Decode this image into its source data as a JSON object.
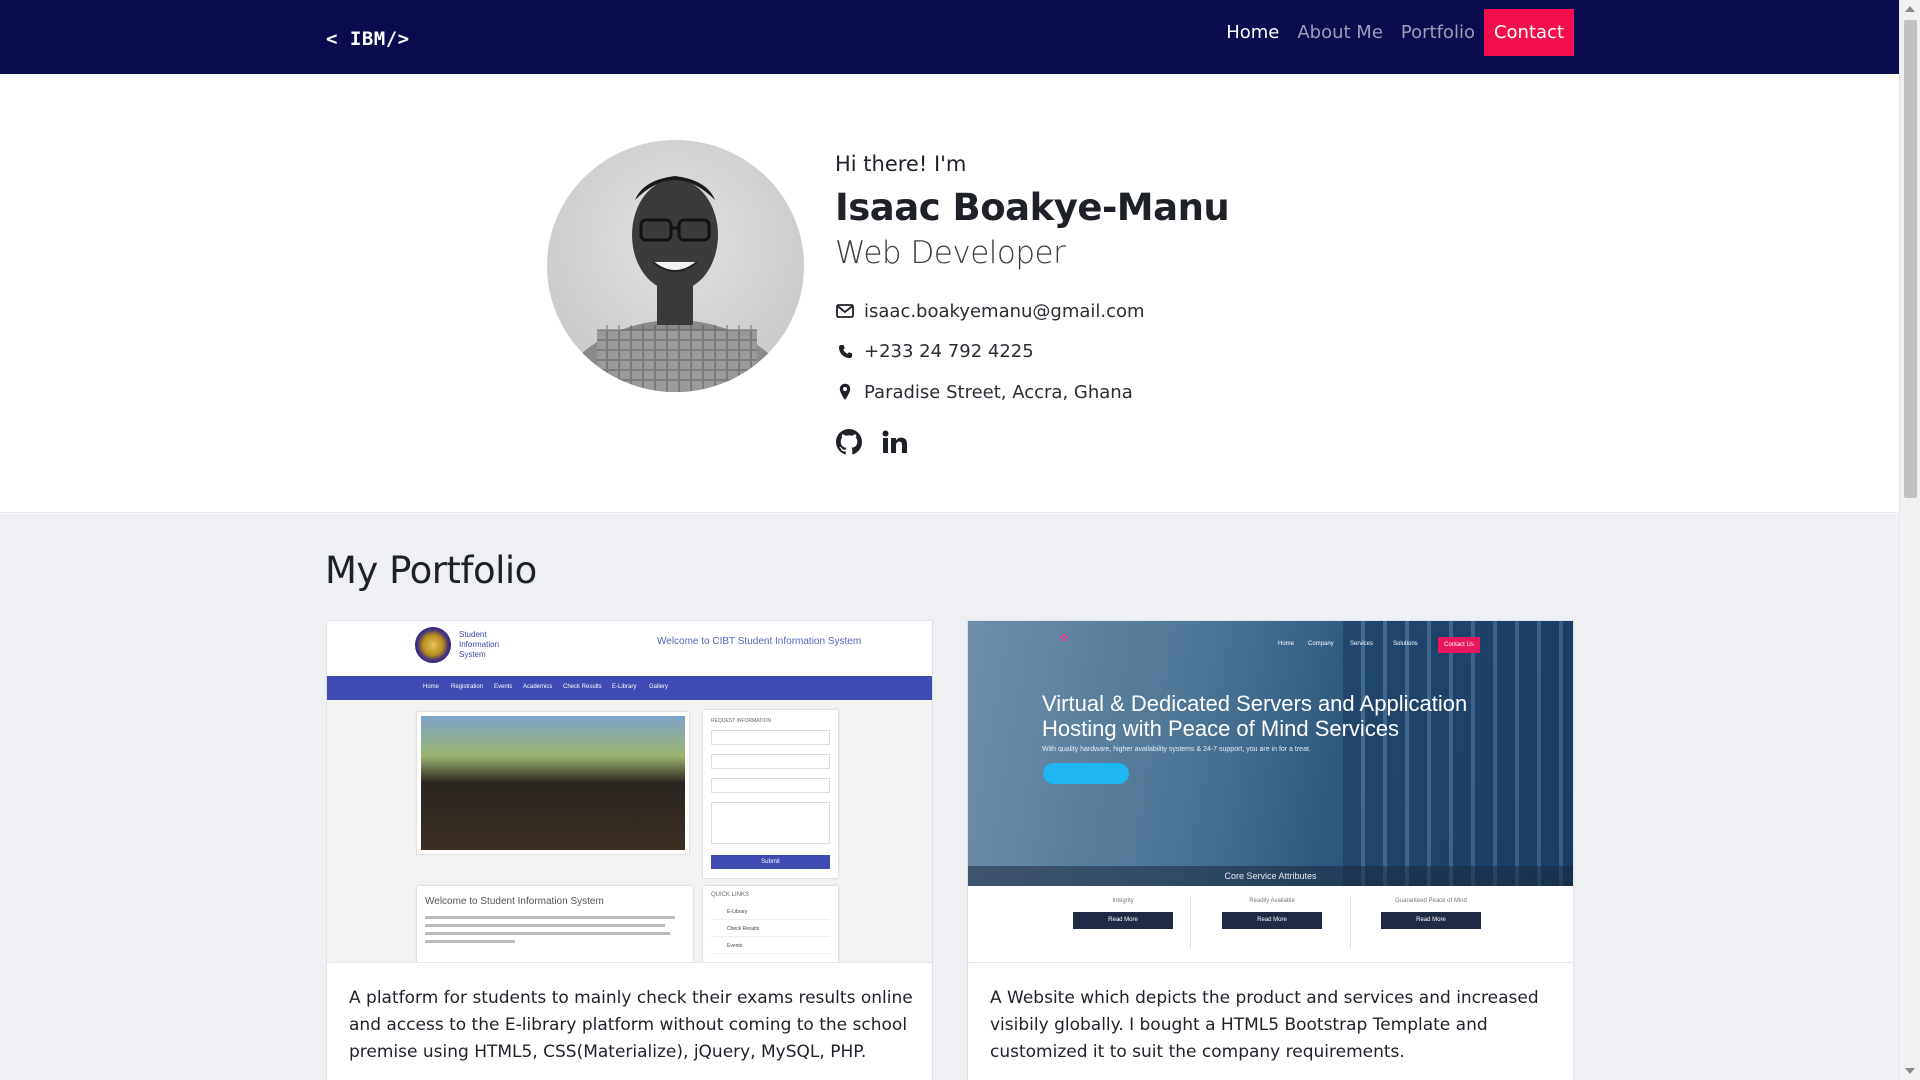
{
  "brand": "< IBM/>",
  "nav": {
    "items": [
      {
        "label": "Home"
      },
      {
        "label": "About Me"
      },
      {
        "label": "Portfolio"
      },
      {
        "label": "Contact"
      }
    ]
  },
  "hero": {
    "greeting": "Hi there! I'm",
    "name": "Isaac Boakye-Manu",
    "role": "Web Developer",
    "email": "isaac.boakyemanu@gmail.com",
    "phone": "+233 24 792 4225",
    "address": "Paradise Street, Accra, Ghana",
    "icons": [
      "envelope-icon",
      "phone-icon",
      "location-pin-icon",
      "github-icon",
      "linkedin-icon"
    ]
  },
  "portfolio": {
    "title": "My Portfolio",
    "projects": [
      {
        "description": "A platform for students to mainly check their exams results online and access to the E-library platform without coming to the school premise using HTML5, CSS(Materialize), jQuery, MySQL, PHP.",
        "screenshot": {
          "logo_text": "Student Information System",
          "welcome": "Welcome to CIBT Student Information System",
          "menu": [
            "Home",
            "Registration",
            "Events",
            "Academics",
            "Check Results",
            "E-Library",
            "Gallery"
          ],
          "form_title": "REQUEST INFORMATION",
          "box_title": "Welcome to Student Information System",
          "quick_links_title": "QUICK LINKS",
          "quick_links": [
            "E-Library",
            "Check Results",
            "Events"
          ],
          "submit": "Submit"
        }
      },
      {
        "description": "A Website which depicts the product and services and increased visibily globally. I bought a HTML5 Bootstrap Template and customized it to suit the company requirements.",
        "screenshot": {
          "menu": [
            "Home",
            "Company",
            "Services",
            "Solutions"
          ],
          "cta": "Contact Us",
          "headline": "Virtual & Dedicated Servers and Application Hosting with Peace of Mind Services",
          "sub": "With quality hardware, higher availability systems & 24-7 support, you are in for a treat.",
          "band": "Core Service Attributes",
          "cols": [
            "Integrity",
            "Readily Available",
            "Guaranteed Peace of Mind"
          ],
          "read_more": "Read More"
        }
      }
    ]
  },
  "colors": {
    "navbar": "#0b0b4f",
    "accent": "#f20f4b",
    "section_bg": "#eef0f3"
  }
}
